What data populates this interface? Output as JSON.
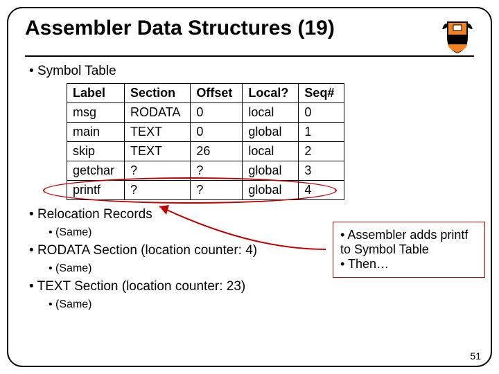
{
  "title": "Assembler Data Structures (19)",
  "page_number": "51",
  "bullets": {
    "symbol_table": "Symbol Table",
    "relocation": "Relocation Records",
    "rodata": "RODATA Section (location counter: 4)",
    "text": "TEXT Section (location counter: 23)",
    "same1": "(Same)",
    "same2": "(Same)",
    "same3": "(Same)"
  },
  "table": {
    "headers": {
      "c0": "Label",
      "c1": "Section",
      "c2": "Offset",
      "c3": "Local?",
      "c4": "Seq#"
    },
    "rows": [
      {
        "c0": "msg",
        "c1": "RODATA",
        "c2": "0",
        "c3": "local",
        "c4": "0"
      },
      {
        "c0": "main",
        "c1": "TEXT",
        "c2": "0",
        "c3": "global",
        "c4": "1"
      },
      {
        "c0": "skip",
        "c1": "TEXT",
        "c2": "26",
        "c3": "local",
        "c4": "2"
      },
      {
        "c0": "getchar",
        "c1": "?",
        "c2": "?",
        "c3": "global",
        "c4": "3"
      },
      {
        "c0": "printf",
        "c1": "?",
        "c2": "?",
        "c3": "global",
        "c4": "4"
      }
    ]
  },
  "callout": {
    "line1": "Assembler adds printf to Symbol Table",
    "line2": "Then…"
  }
}
